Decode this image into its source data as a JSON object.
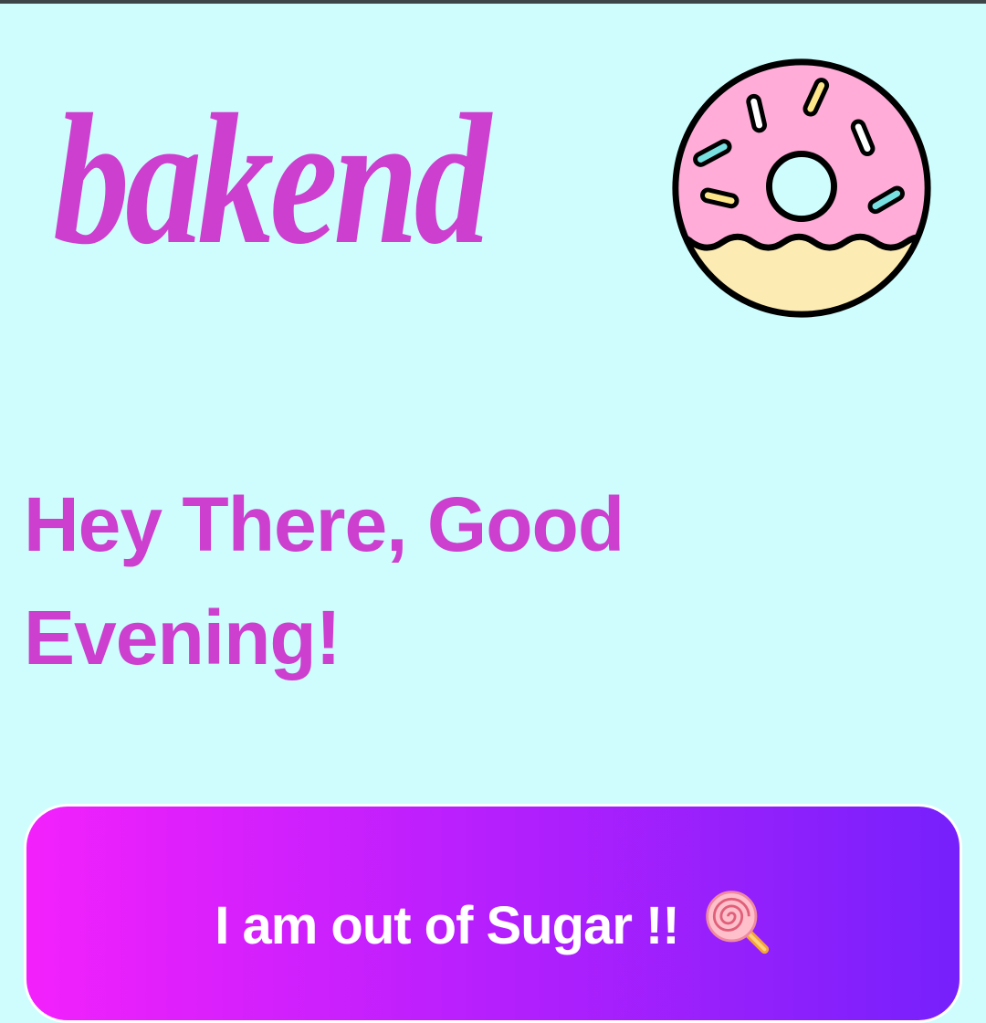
{
  "header": {
    "brand": "bakend",
    "brand_icon": "donut-icon"
  },
  "main": {
    "greeting": "Hey There, Good Evening!"
  },
  "action": {
    "label": "I am out of Sugar !!",
    "icon": "lollipop-icon"
  },
  "colors": {
    "background": "#cffdfd",
    "accent": "#cc3fcf",
    "button_gradient_start": "#f321fc",
    "button_gradient_end": "#7620fc",
    "button_text": "#ffffff"
  }
}
